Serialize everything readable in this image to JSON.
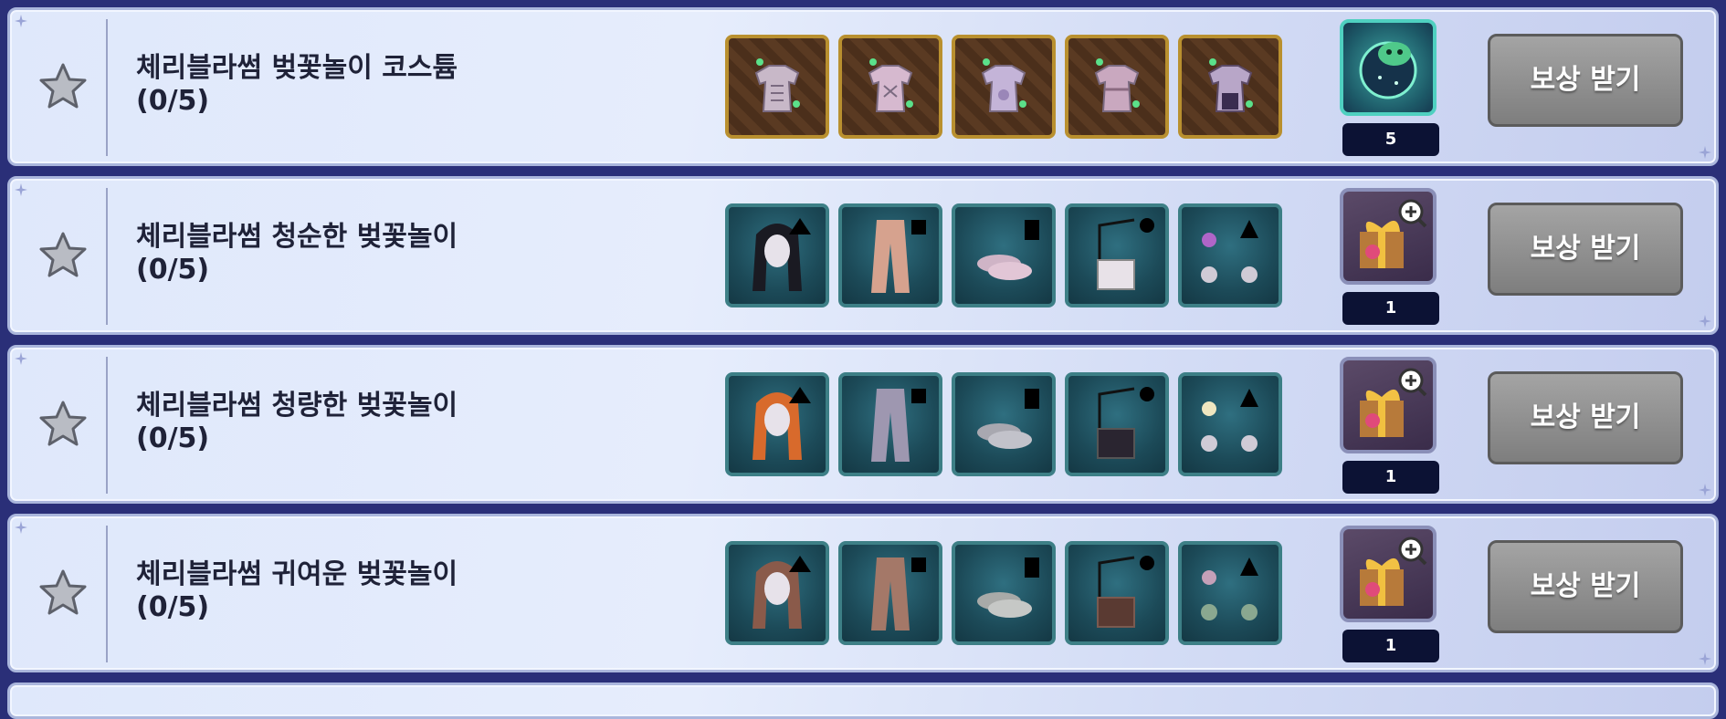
{
  "colors": {
    "panel": "#dfe8fb",
    "panel_border": "#aab6dc",
    "background": "#2a2f78",
    "button": "#8f8f8f",
    "count_bg": "#0c1234",
    "slot_gold_border": "#b9902f",
    "slot_teal_border": "#3d7f86"
  },
  "rows": [
    {
      "title": "체리블라썸 벚꽃놀이 코스튬",
      "progress": "(0/5)",
      "items": [
        "costume-top-icon",
        "costume-top-icon",
        "costume-top-icon",
        "costume-top-icon",
        "costume-top-icon"
      ],
      "reward": {
        "icon": "green-creature-orb-icon",
        "count": "5"
      },
      "button_label": "보상 받기"
    },
    {
      "title": "체리블라썸 청순한 벚꽃놀이",
      "progress": "(0/5)",
      "items": [
        "black-hair-icon",
        "pink-pants-icon",
        "pink-shoes-icon",
        "white-bag-icon",
        "flower-earrings-icon"
      ],
      "reward": {
        "icon": "gift-box-magnifier-icon",
        "count": "1"
      },
      "button_label": "보상 받기"
    },
    {
      "title": "체리블라썸 청량한 벚꽃놀이",
      "progress": "(0/5)",
      "items": [
        "orange-hair-icon",
        "gray-pants-icon",
        "gray-shoes-icon",
        "black-bag-icon",
        "flower-earrings-icon"
      ],
      "reward": {
        "icon": "gift-box-magnifier-icon",
        "count": "1"
      },
      "button_label": "보상 받기"
    },
    {
      "title": "체리블라썸 귀여운 벚꽃놀이",
      "progress": "(0/5)",
      "items": [
        "brown-hair-icon",
        "brown-pants-icon",
        "gray-shoes-icon",
        "brown-bag-icon",
        "flower-earrings-icon"
      ],
      "reward": {
        "icon": "gift-box-magnifier-icon",
        "count": "1"
      },
      "button_label": "보상 받기"
    }
  ]
}
